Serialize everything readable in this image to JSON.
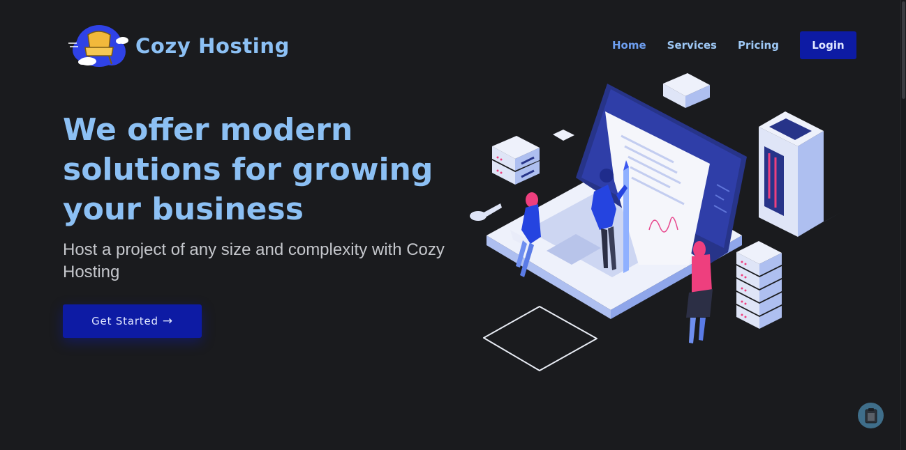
{
  "brand": {
    "name": "Cozy Hosting",
    "logo_icon": "armchair-cloud-logo"
  },
  "nav": {
    "items": [
      {
        "label": "Home",
        "active": true
      },
      {
        "label": "Services",
        "active": false
      },
      {
        "label": "Pricing",
        "active": false
      }
    ],
    "login_label": "Login"
  },
  "hero": {
    "title": "We offer modern solutions for growing your business",
    "subtitle": "Host a project of any size and complexity with Cozy Hosting",
    "cta_label": "Get Started",
    "cta_icon": "arrow-right-icon",
    "illustration": "isometric-laptop-servers-illustration"
  },
  "floating_button": {
    "icon": "clipboard-icon"
  },
  "colors": {
    "background": "#1a1b1e",
    "accent": "#0d1ba4",
    "heading": "#8cc0f4",
    "nav_active": "#6e9ff0"
  }
}
